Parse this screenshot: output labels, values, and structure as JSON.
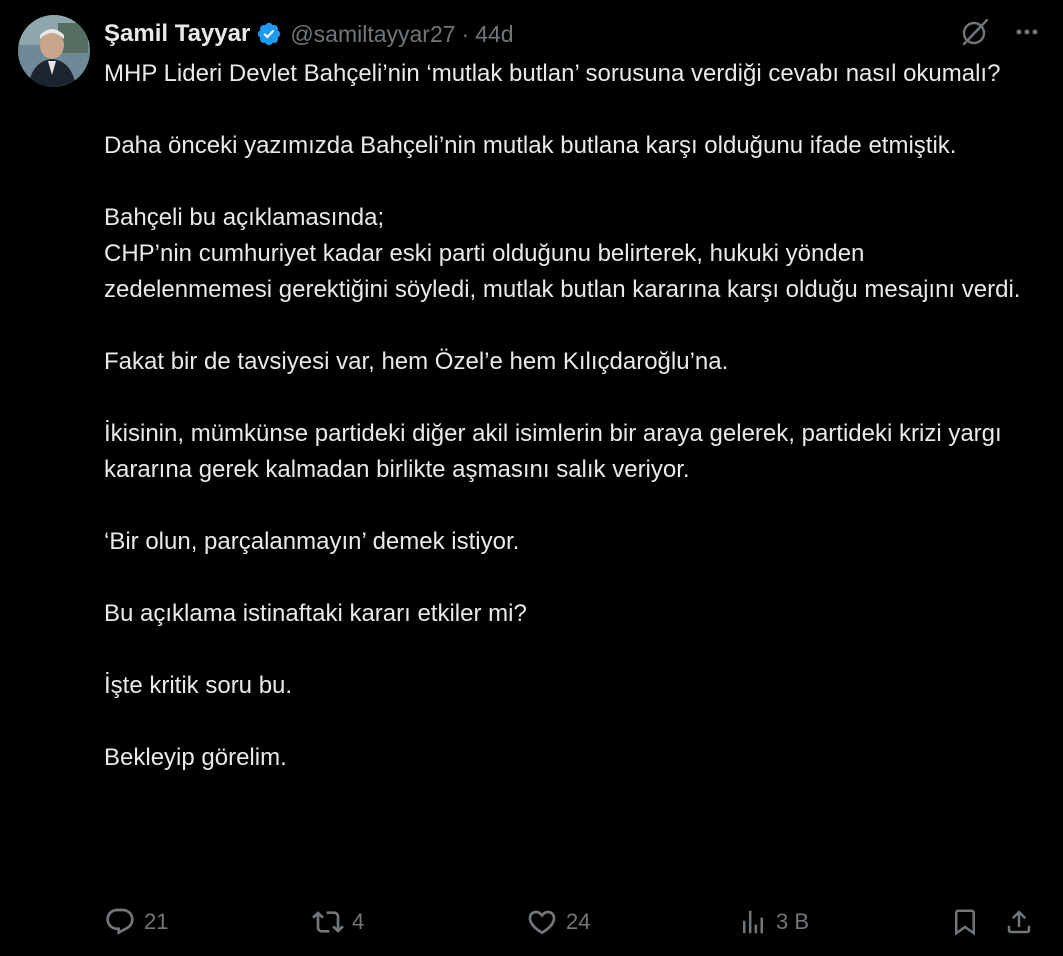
{
  "author": {
    "name": "Şamil Tayyar",
    "handle": "@samiltayyar27",
    "separator": "·",
    "time": "44d",
    "verified": true,
    "verified_color": "#1d9bf0"
  },
  "icons": {
    "grok": "grok-icon",
    "more": "more-icon",
    "reply": "reply-icon",
    "retweet": "retweet-icon",
    "like": "heart-icon",
    "views": "views-icon",
    "bookmark": "bookmark-icon",
    "share": "share-icon"
  },
  "tweet": {
    "paragraphs": [
      "MHP Lideri Devlet Bahçeli’nin ‘mutlak butlan’ sorusuna verdiği cevabı nasıl okumalı?",
      "Daha önceki yazımızda Bahçeli’nin mutlak butlana karşı olduğunu ifade etmiştik.",
      "Bahçeli bu açıklamasında;\nCHP’nin cumhuriyet kadar eski parti olduğunu belirterek, hukuki yönden zedelenmemesi gerektiğini söyledi, mutlak butlan kararına karşı olduğu mesajını verdi.",
      "Fakat bir de tavsiyesi var, hem Özel’e hem Kılıçdaroğlu’na.",
      "İkisinin, mümkünse partideki diğer akil isimlerin bir araya gelerek, partideki krizi yargı kararına gerek kalmadan birlikte aşmasını salık veriyor.",
      "‘Bir olun, parçalanmayın’ demek istiyor.",
      "Bu açıklama istinaftaki kararı etkiler mi?",
      "İşte kritik soru bu.",
      "Bekleyip görelim."
    ]
  },
  "actions": {
    "replies": "21",
    "retweets": "4",
    "likes": "24",
    "views": "3 B"
  },
  "colors": {
    "background": "#000000",
    "text": "#e7e9ea",
    "muted": "#71767b"
  }
}
